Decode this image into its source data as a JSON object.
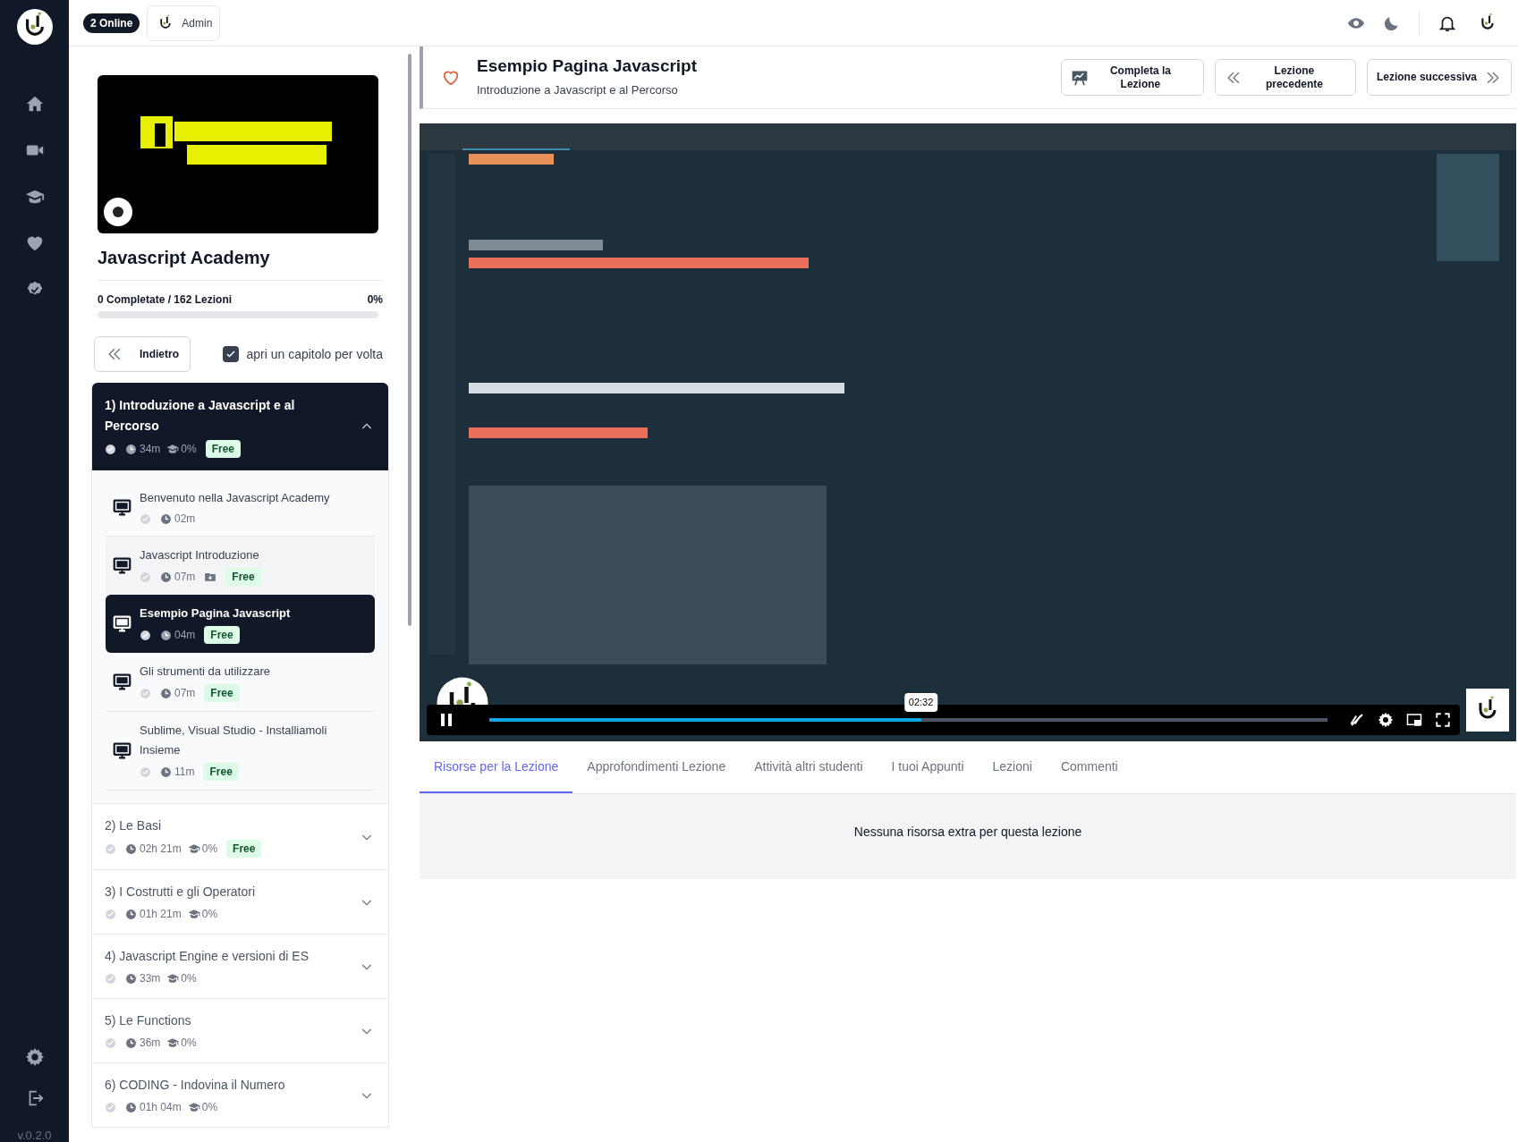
{
  "sidebar": {
    "version": "v.0.2.0"
  },
  "topbar": {
    "online_badge": "2 Online",
    "user": "Admin"
  },
  "course": {
    "title": "Javascript Academy",
    "progress_text": "0 Completate / 162 Lezioni",
    "percent": "0%",
    "level": 0,
    "back_button": "Indietro",
    "one_chapter": {
      "label": "apri un capitolo per volta",
      "checked": true
    }
  },
  "chapters": [
    {
      "title": "1) Introduzione a Javascript e al Percorso",
      "duration": "34m",
      "progress": "0%",
      "badge": "Free",
      "expanded": true,
      "lessons": [
        {
          "title": "Benvenuto nella Javascript Academy",
          "duration": "02m",
          "resources": false,
          "selected": false,
          "highlighted": false
        },
        {
          "title": "Javascript Introduzione",
          "duration": "07m",
          "resources": true,
          "badge": "Free",
          "selected": false,
          "highlighted": true
        },
        {
          "title": "Esempio Pagina Javascript",
          "duration": "04m",
          "resources": false,
          "badge": "Free",
          "selected": true,
          "highlighted": false
        },
        {
          "title": "Gli strumenti da utilizzare",
          "duration": "07m",
          "resources": false,
          "badge": "Free",
          "selected": false,
          "highlighted": false
        },
        {
          "title": "Sublime, Visual Studio - Installiamoli Insieme",
          "duration": "11m",
          "resources": false,
          "badge": "Free",
          "selected": false,
          "highlighted": false
        }
      ]
    },
    {
      "title": "2) Le Basi",
      "duration": "02h 21m",
      "progress": "0%",
      "badge": "Free",
      "expanded": false
    },
    {
      "title": "3) I Costrutti e gli Operatori",
      "duration": "01h 21m",
      "progress": "0%",
      "expanded": false
    },
    {
      "title": "4) Javascript Engine e versioni di ES",
      "duration": "33m",
      "progress": "0%",
      "expanded": false
    },
    {
      "title": "5) Le Functions",
      "duration": "36m",
      "progress": "0%",
      "expanded": false
    },
    {
      "title": "6) CODING - Indovina il Numero",
      "duration": "01h 04m",
      "progress": "0%",
      "expanded": false
    }
  ],
  "lesson": {
    "title": "Esempio Pagina Javascript",
    "subtitle": "Introduzione a Javascript e al Percorso",
    "favorite": false,
    "buttons": [
      {
        "kind": "complete",
        "label": "Completa la Lezione"
      },
      {
        "kind": "previous",
        "label": "Lezione precedente"
      },
      {
        "kind": "next",
        "label": "Lezione successiva"
      }
    ]
  },
  "video": {
    "time": "02:32",
    "level": 0.515,
    "playing": true
  },
  "tabs": [
    {
      "label": "Risorse per la Lezione",
      "selected": true
    },
    {
      "label": "Approfondimenti Lezione",
      "selected": false
    },
    {
      "label": "Attività altri studenti",
      "selected": false
    },
    {
      "label": "I tuoi Appunti",
      "selected": false
    },
    {
      "label": "Lezioni",
      "selected": false
    },
    {
      "label": "Commenti",
      "selected": false
    }
  ],
  "tab_content": "Nessuna risorsa extra per questa lezione"
}
